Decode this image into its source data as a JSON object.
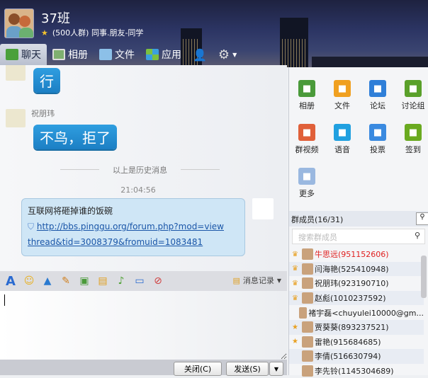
{
  "header": {
    "group_name": "37班",
    "subtitle": "(500人群) 同事.朋友-同学"
  },
  "tabs": [
    {
      "label": "聊天",
      "icon": "chat-icon",
      "active": true
    },
    {
      "label": "相册",
      "icon": "album-icon"
    },
    {
      "label": "文件",
      "icon": "folder-icon"
    },
    {
      "label": "应用",
      "icon": "apps-icon"
    }
  ],
  "messages": [
    {
      "sender": "",
      "text": "行"
    },
    {
      "sender": "祝朋玮",
      "text": "不鸟，拒了"
    }
  ],
  "history_divider": "以上是历史消息",
  "timestamp": "21:04:56",
  "my_message": {
    "title": "互联网将砸掉谁的饭碗",
    "link_line1": "http://bbs.pinggu.org/forum.php?mod=view",
    "link_line2": "thread&tid=3008379&fromuid=1083481"
  },
  "toolbar": {
    "history_label": "消息记录"
  },
  "footer": {
    "close_label": "关闭(C)",
    "send_label": "发送(S)"
  },
  "apps": [
    {
      "label": "相册",
      "color": "#4a9a3a",
      "icon": "album-icon"
    },
    {
      "label": "文件",
      "color": "#f0a020",
      "icon": "folder-icon"
    },
    {
      "label": "论坛",
      "color": "#2f7fd8",
      "icon": "forum-icon"
    },
    {
      "label": "讨论组",
      "color": "#5aa02a",
      "icon": "discussion-icon"
    },
    {
      "label": "群视频",
      "color": "#e0603a",
      "icon": "video-icon"
    },
    {
      "label": "语音",
      "color": "#20a0e0",
      "icon": "voice-icon"
    },
    {
      "label": "投票",
      "color": "#3a8ae0",
      "icon": "vote-icon"
    },
    {
      "label": "签到",
      "color": "#6aaa20",
      "icon": "checkin-icon"
    },
    {
      "label": "更多",
      "color": "#9ab8e0",
      "icon": "more-icon"
    }
  ],
  "members": {
    "header": "群成员(16/31)",
    "search_placeholder": "搜索群成员",
    "list": [
      {
        "name": "牛思远(951152606)",
        "role": "admin",
        "color": "#e02020"
      },
      {
        "name": "闫海艳(525410948)",
        "role": "admin"
      },
      {
        "name": "祝朋玮(923190710)",
        "role": "admin"
      },
      {
        "name": "赵彪(1010237592)",
        "role": "admin"
      },
      {
        "name": "褚宇磊<chuyulei10000@gm...",
        "role": ""
      },
      {
        "name": "贾葵葵(893237521)",
        "role": "star"
      },
      {
        "name": "雷艳(915684685)",
        "role": "star"
      },
      {
        "name": "李倩(516630794)",
        "role": ""
      },
      {
        "name": "李先铃(1145304689)",
        "role": ""
      }
    ]
  }
}
